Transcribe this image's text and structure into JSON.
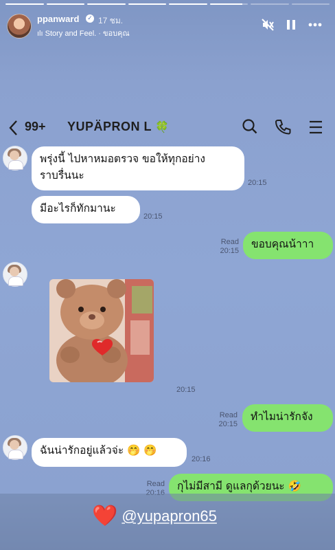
{
  "story": {
    "progress": [
      1,
      1,
      1,
      1,
      1,
      0.85,
      0,
      0
    ],
    "username": "ppanward",
    "time_ago": "17 ชม.",
    "music_label": "Story and Feel. · ขอบคุณ",
    "icons": [
      "mute-icon",
      "pause-icon",
      "more-icon"
    ]
  },
  "chat": {
    "back_icon": "chevron-left-icon",
    "unread_count": "99+",
    "contact_name": "YUPÄPRON L",
    "contact_emoji": "🍀",
    "header_icons": [
      "search-icon",
      "phone-icon",
      "menu-icon"
    ],
    "messages": [
      {
        "side": "in",
        "lines": [
          "พรุ่งนี้ ไปหาหมอตรวจ ขอให้ทุกอย่าง",
          "ราบรื่นนะ"
        ],
        "time": "20:15"
      },
      {
        "side": "in",
        "lines": [
          "มีอะไรก็ทักมานะ"
        ],
        "time": "20:15"
      },
      {
        "side": "out",
        "lines": [
          "ขอบคุณน้าาา"
        ],
        "read": "Read",
        "time": "20:15"
      },
      {
        "side": "in",
        "type": "sticker",
        "description": "teddy-bear-heart-sticker",
        "time": "20:15"
      },
      {
        "side": "out",
        "lines": [
          "ทำไมน่ารักจัง"
        ],
        "read": "Read",
        "time": "20:15"
      },
      {
        "side": "in",
        "lines": [
          "ฉันน่ารักอยู่แล้วจ่ะ 🤭 🤭"
        ],
        "time": "20:16"
      },
      {
        "side": "out",
        "lines": [
          "กุไม่มีสามี ดูแลกุด้วยนะ 🤣"
        ],
        "read": "Read",
        "time": "20:16"
      }
    ]
  },
  "mention": {
    "emoji": "❤️",
    "handle": "@yupapron65"
  },
  "colors": {
    "background": "#8fa6d4",
    "incoming_bubble": "#ffffff",
    "outgoing_bubble": "#85e36f",
    "heart": "#e02020"
  }
}
